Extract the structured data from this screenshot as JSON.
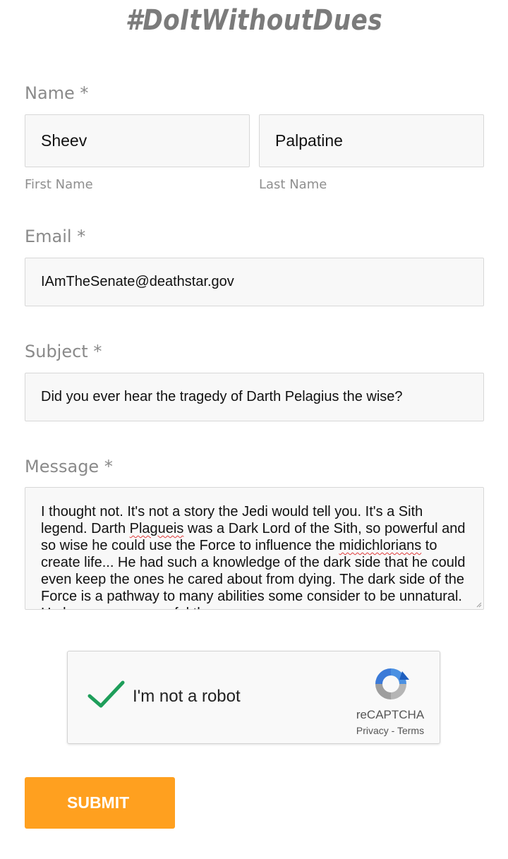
{
  "header": {
    "title": "#DoItWithoutDues"
  },
  "form": {
    "name": {
      "label": "Name *",
      "first_value": "Sheev",
      "first_sublabel": "First Name",
      "last_value": "Palpatine",
      "last_sublabel": "Last Name"
    },
    "email": {
      "label": "Email *",
      "value": "IAmTheSenate@deathstar.gov"
    },
    "subject": {
      "label": "Subject *",
      "value": "Did you ever hear the tragedy of Darth Pelagius the wise?"
    },
    "message": {
      "label": "Message *",
      "part1": "I thought not. It's not a story the Jedi would tell you. It's a Sith legend. Darth ",
      "word1": "Plagueis",
      "part2": " was a Dark Lord of the Sith, so powerful and so wise he could use the Force to influence the ",
      "word2": "midichlorians",
      "part3": " to create life... He had such a knowledge of the dark side that he could even keep the ones he cared about from dying. The dark side of the Force is a pathway to many abilities some consider to be unnatural. He became so powerful the"
    },
    "captcha": {
      "label": "I'm not a robot",
      "brand": "reCAPTCHA",
      "privacy": "Privacy",
      "separator": " - ",
      "terms": "Terms",
      "checked": true
    },
    "submit_label": "SUBMIT"
  },
  "colors": {
    "accent": "#ffa01f",
    "check": "#1e9e5a",
    "heading": "#7b7b7b"
  }
}
